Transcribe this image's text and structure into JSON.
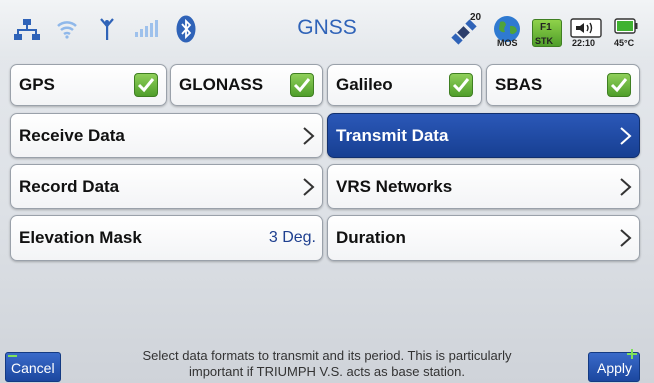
{
  "header": {
    "title": "GNSS",
    "satellite_count": "20",
    "mode_label": "MOS",
    "fix_top": "F1",
    "fix_bottom": "STK",
    "time": "22:10",
    "temperature": "45°C"
  },
  "constellations": [
    {
      "label": "GPS",
      "checked": true
    },
    {
      "label": "GLONASS",
      "checked": true
    },
    {
      "label": "Galileo",
      "checked": true
    },
    {
      "label": "SBAS",
      "checked": true
    }
  ],
  "menu": {
    "receive_data": "Receive Data",
    "transmit_data": "Transmit Data",
    "record_data": "Record Data",
    "vrs_networks": "VRS Networks",
    "elevation_mask": "Elevation Mask",
    "elevation_mask_value": "3 Deg.",
    "duration": "Duration"
  },
  "footer": {
    "hint_line1": "Select data  formats to transmit and its period. This is particularly",
    "hint_line2": "important if TRIUMPH V.S. acts as base station.",
    "cancel": "Cancel",
    "apply": "Apply"
  },
  "colors": {
    "title": "#2f63b8",
    "selected_tile": "#1f4aa3",
    "checkbox": "#5aa832",
    "button": "#2a58b4"
  }
}
